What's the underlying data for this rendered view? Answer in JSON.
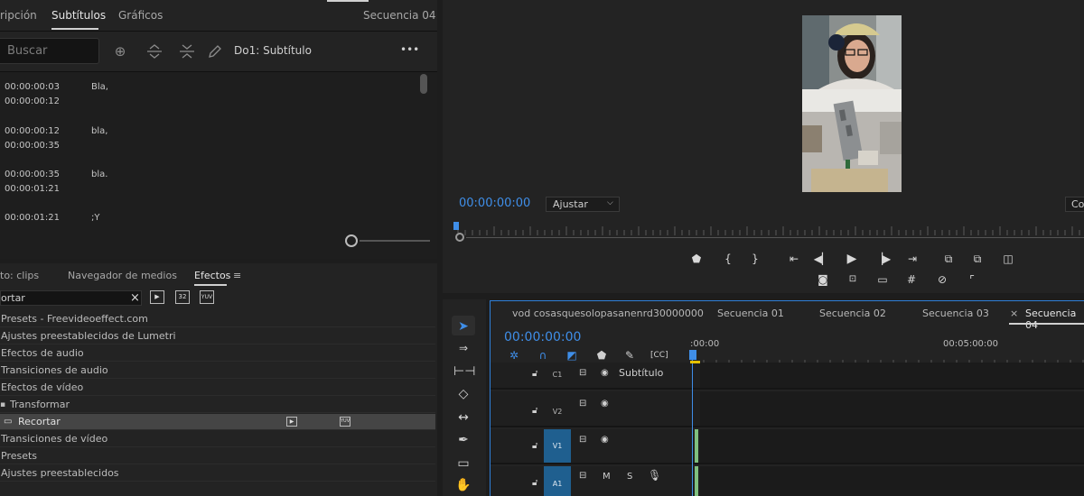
{
  "captions": {
    "tabs": [
      "ripción",
      "Subtítulos",
      "Gráficos"
    ],
    "sequence_label": "Secuencia 04",
    "search_placeholder": "Buscar",
    "track_label": "Do1: Subtítulo",
    "more": "•••",
    "rows": [
      {
        "in": "00:00:00:03",
        "out": "00:00:00:12",
        "text": "Bla,"
      },
      {
        "in": "00:00:00:12",
        "out": "00:00:00:35",
        "text": "bla,"
      },
      {
        "in": "00:00:00:35",
        "out": "00:00:01:21",
        "text": "bla."
      },
      {
        "in": "00:00:01:21",
        "out": "",
        "text": ";Y"
      }
    ]
  },
  "effects": {
    "tabs": [
      "to: clips",
      "Navegador de medios",
      "Efectos"
    ],
    "menu_icon": "≡",
    "search_value": "ortar",
    "items": [
      "Presets - Freevideoeffect.com",
      "Ajustes preestablecidos de Lumetri",
      "Efectos de audio",
      "Transiciones de audio",
      "Efectos de vídeo",
      "Transformar",
      "Recortar",
      "Transiciones de vídeo",
      "Presets",
      "Ajustes preestablecidos"
    ]
  },
  "monitor": {
    "timecode": "00:00:00:00",
    "fit_label": "Ajustar",
    "fit_arrow": "⌵",
    "full_label": "Co"
  },
  "timeline": {
    "tabs": [
      "vod cosasquesolopasanenrd30000000",
      "Secuencia 01",
      "Secuencia 02",
      "Secuencia 03",
      "Secuencia 04"
    ],
    "close_glyph": "×",
    "timecode": "00:00:00:00",
    "ruler_start": ":00:00",
    "ruler_mark": "00:05:00:00",
    "tracks": {
      "c1": {
        "name": "C1",
        "label": "Subtítulo"
      },
      "v2": {
        "name": "V2"
      },
      "v1": {
        "name": "V1"
      },
      "a1": {
        "name": "A1",
        "m": "M",
        "s": "S"
      }
    }
  },
  "colors": {
    "accent": "#3f8ee8",
    "track_blue": "#1f5f8f",
    "playhead_yellow": "#e6c200"
  }
}
